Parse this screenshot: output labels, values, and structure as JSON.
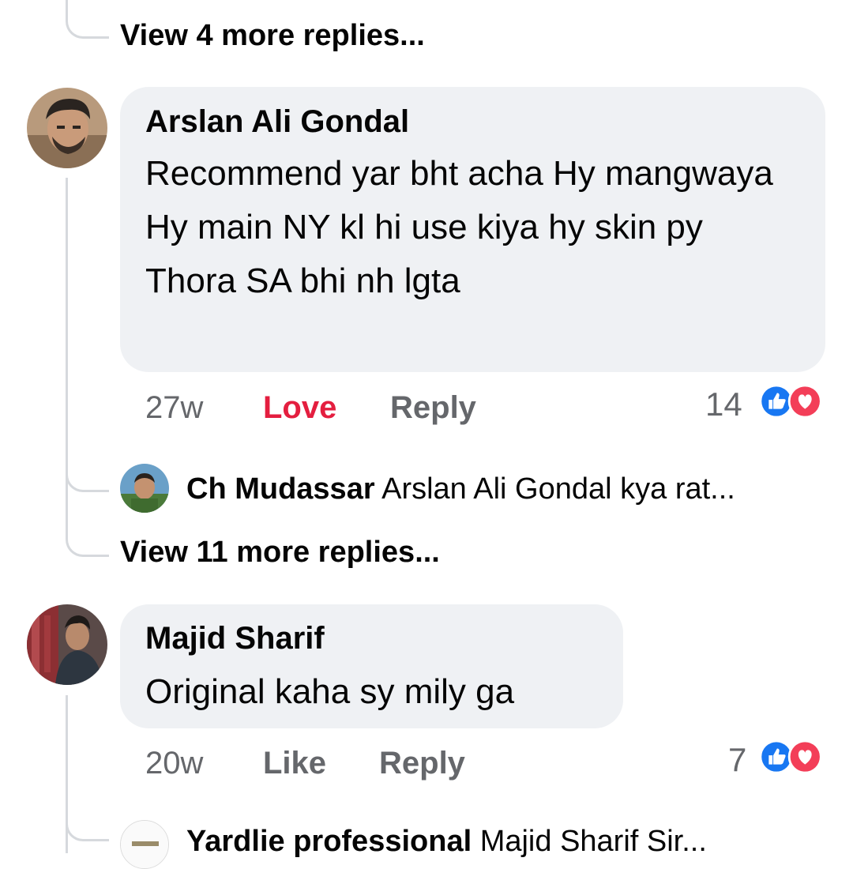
{
  "thread1": {
    "view_more": "View 4 more replies..."
  },
  "comment1": {
    "author": "Arslan Ali Gondal",
    "text": "Recommend yar bht acha Hy mangwaya Hy main NY kl hi use kiya hy skin py Thora SA bhi nh lgta",
    "time": "27w",
    "reaction_action": "Love",
    "reply_action": "Reply",
    "reaction_count": "14",
    "reply_preview": {
      "author": "Ch Mudassar",
      "snippet": "Arslan Ali Gondal kya rat..."
    },
    "view_more": "View 11 more replies..."
  },
  "comment2": {
    "author": "Majid Sharif",
    "text": "Original kaha sy mily ga",
    "time": "20w",
    "reaction_action": "Like",
    "reply_action": "Reply",
    "reaction_count": "7",
    "reply_preview": {
      "author": "Yardlie professional",
      "snippet": "Majid Sharif Sir..."
    }
  },
  "colors": {
    "bubble": "#eff1f4",
    "love": "#e41e3f",
    "meta": "#65676b",
    "like_blue": "#1877f2",
    "love_red": "#f33e58",
    "thread_line": "#d6d9dd"
  },
  "icons": [
    "like-reaction-icon",
    "love-reaction-icon"
  ]
}
